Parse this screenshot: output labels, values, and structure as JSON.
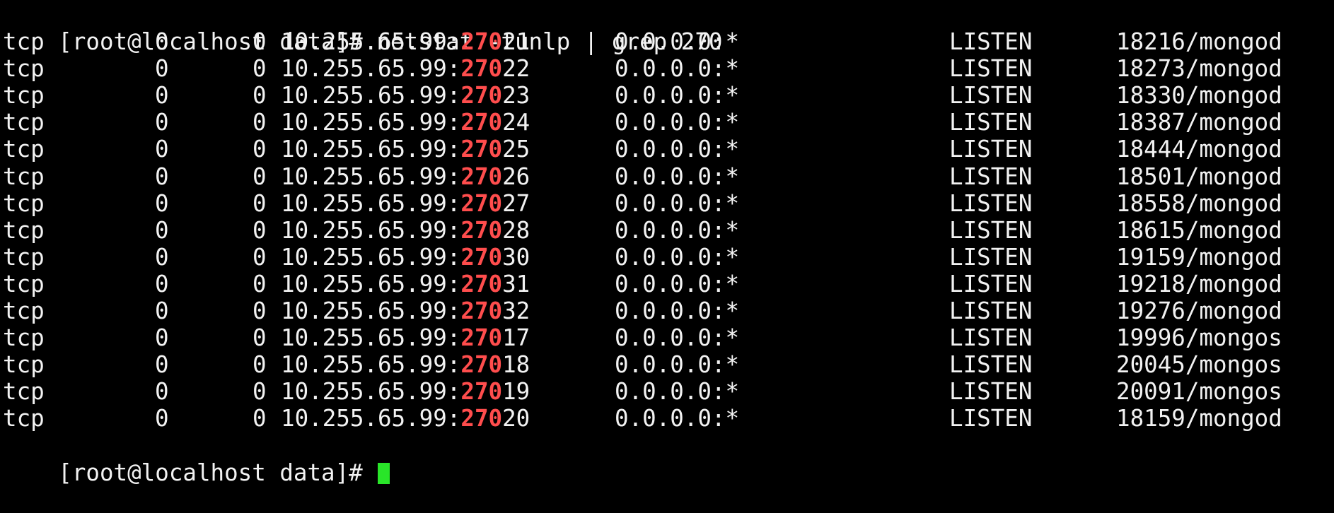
{
  "terminal": {
    "command_line": "[root@localhost data]# netstat -tunlp | grep 270",
    "final_prompt": "[root@localhost data]# ",
    "highlight_text": "270",
    "colors": {
      "background": "#000000",
      "text": "#f2f2f2",
      "highlight": "#ff4d4d",
      "cursor": "#29e529"
    },
    "rows": [
      {
        "proto": "tcp",
        "recvq": "0",
        "sendq": "0",
        "local_prefix": "10.255.65.99:",
        "port_match": "270",
        "port_rest": "21",
        "foreign": "0.0.0.0:*",
        "state": "LISTEN",
        "pid": "18216/mongod"
      },
      {
        "proto": "tcp",
        "recvq": "0",
        "sendq": "0",
        "local_prefix": "10.255.65.99:",
        "port_match": "270",
        "port_rest": "22",
        "foreign": "0.0.0.0:*",
        "state": "LISTEN",
        "pid": "18273/mongod"
      },
      {
        "proto": "tcp",
        "recvq": "0",
        "sendq": "0",
        "local_prefix": "10.255.65.99:",
        "port_match": "270",
        "port_rest": "23",
        "foreign": "0.0.0.0:*",
        "state": "LISTEN",
        "pid": "18330/mongod"
      },
      {
        "proto": "tcp",
        "recvq": "0",
        "sendq": "0",
        "local_prefix": "10.255.65.99:",
        "port_match": "270",
        "port_rest": "24",
        "foreign": "0.0.0.0:*",
        "state": "LISTEN",
        "pid": "18387/mongod"
      },
      {
        "proto": "tcp",
        "recvq": "0",
        "sendq": "0",
        "local_prefix": "10.255.65.99:",
        "port_match": "270",
        "port_rest": "25",
        "foreign": "0.0.0.0:*",
        "state": "LISTEN",
        "pid": "18444/mongod"
      },
      {
        "proto": "tcp",
        "recvq": "0",
        "sendq": "0",
        "local_prefix": "10.255.65.99:",
        "port_match": "270",
        "port_rest": "26",
        "foreign": "0.0.0.0:*",
        "state": "LISTEN",
        "pid": "18501/mongod"
      },
      {
        "proto": "tcp",
        "recvq": "0",
        "sendq": "0",
        "local_prefix": "10.255.65.99:",
        "port_match": "270",
        "port_rest": "27",
        "foreign": "0.0.0.0:*",
        "state": "LISTEN",
        "pid": "18558/mongod"
      },
      {
        "proto": "tcp",
        "recvq": "0",
        "sendq": "0",
        "local_prefix": "10.255.65.99:",
        "port_match": "270",
        "port_rest": "28",
        "foreign": "0.0.0.0:*",
        "state": "LISTEN",
        "pid": "18615/mongod"
      },
      {
        "proto": "tcp",
        "recvq": "0",
        "sendq": "0",
        "local_prefix": "10.255.65.99:",
        "port_match": "270",
        "port_rest": "30",
        "foreign": "0.0.0.0:*",
        "state": "LISTEN",
        "pid": "19159/mongod"
      },
      {
        "proto": "tcp",
        "recvq": "0",
        "sendq": "0",
        "local_prefix": "10.255.65.99:",
        "port_match": "270",
        "port_rest": "31",
        "foreign": "0.0.0.0:*",
        "state": "LISTEN",
        "pid": "19218/mongod"
      },
      {
        "proto": "tcp",
        "recvq": "0",
        "sendq": "0",
        "local_prefix": "10.255.65.99:",
        "port_match": "270",
        "port_rest": "32",
        "foreign": "0.0.0.0:*",
        "state": "LISTEN",
        "pid": "19276/mongod"
      },
      {
        "proto": "tcp",
        "recvq": "0",
        "sendq": "0",
        "local_prefix": "10.255.65.99:",
        "port_match": "270",
        "port_rest": "17",
        "foreign": "0.0.0.0:*",
        "state": "LISTEN",
        "pid": "19996/mongos"
      },
      {
        "proto": "tcp",
        "recvq": "0",
        "sendq": "0",
        "local_prefix": "10.255.65.99:",
        "port_match": "270",
        "port_rest": "18",
        "foreign": "0.0.0.0:*",
        "state": "LISTEN",
        "pid": "20045/mongos"
      },
      {
        "proto": "tcp",
        "recvq": "0",
        "sendq": "0",
        "local_prefix": "10.255.65.99:",
        "port_match": "270",
        "port_rest": "19",
        "foreign": "0.0.0.0:*",
        "state": "LISTEN",
        "pid": "20091/mongos"
      },
      {
        "proto": "tcp",
        "recvq": "0",
        "sendq": "0",
        "local_prefix": "10.255.65.99:",
        "port_match": "270",
        "port_rest": "20",
        "foreign": "0.0.0.0:*",
        "state": "LISTEN",
        "pid": "18159/mongod"
      }
    ]
  }
}
